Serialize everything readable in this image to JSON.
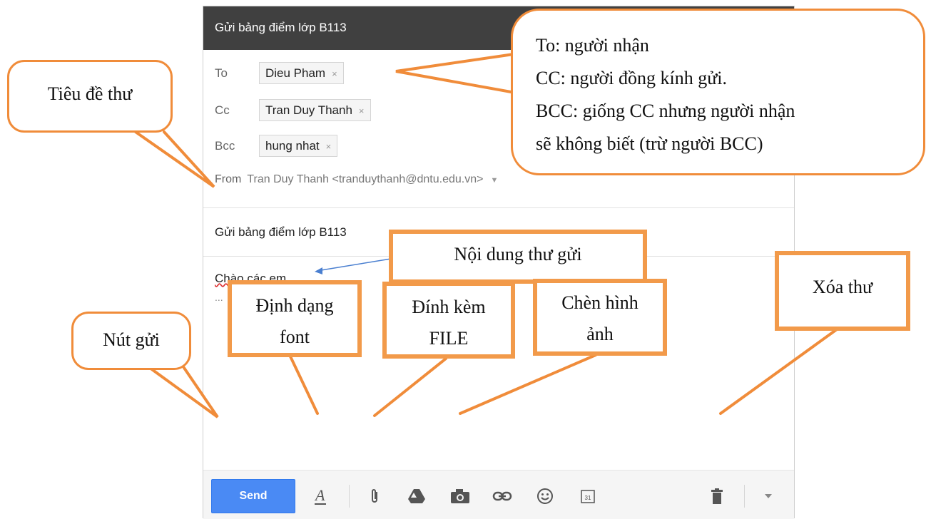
{
  "compose": {
    "title": "Gửi bảng điểm lớp B113",
    "to_label": "To",
    "cc_label": "Cc",
    "bcc_label": "Bcc",
    "from_label": "From",
    "to_chip": "Dieu Pham",
    "cc_chip": "Tran Duy Thanh",
    "bcc_chip": "hung nhat",
    "chip_remove": "×",
    "from_value": "Tran Duy Thanh <tranduythanh@dntu.edu.vn>",
    "subject": "Gửi bảng điểm lớp B113",
    "body_line1": "Chào các em",
    "body_line2": "...",
    "calendar_day": "31"
  },
  "toolbar": {
    "send_label": "Send",
    "icons": [
      "formatting-icon",
      "attach-icon",
      "drive-icon",
      "photo-icon",
      "link-icon",
      "emoji-icon",
      "calendar-icon",
      "trash-icon",
      "more-options-icon"
    ]
  },
  "annotations": {
    "recipients_l1": "To: người nhận",
    "recipients_l2": "CC: người đồng kính gửi.",
    "recipients_l3": "BCC: giống CC nhưng người nhận",
    "recipients_l4": "sẽ không biết (trừ người BCC)",
    "subject_note": "Tiêu đề thư",
    "body_note": "Nội dung thư gửi",
    "send_note": "Nút gửi",
    "format_l1": "Định dạng",
    "format_l2": "font",
    "attach_l1": "Đính kèm",
    "attach_l2": "FILE",
    "image_l1": "Chèn hình",
    "image_l2": "ảnh",
    "delete_note": "Xóa thư"
  },
  "colors": {
    "callout_border": "#f08c3a",
    "send_button": "#4a8af4",
    "titlebar": "#404040"
  }
}
